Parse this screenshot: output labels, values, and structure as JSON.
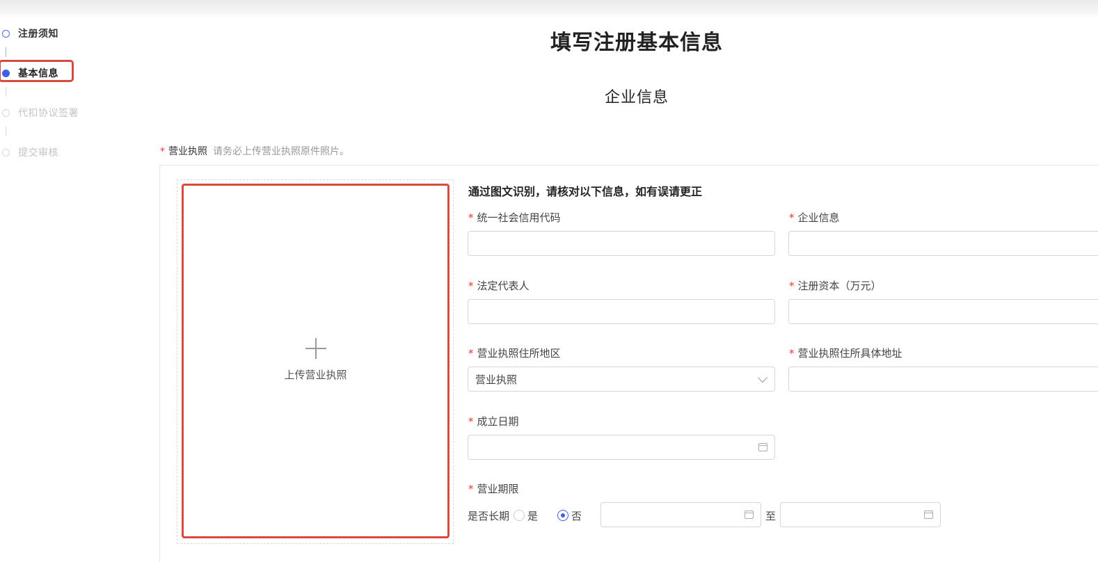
{
  "steps": [
    {
      "label": "注册须知",
      "state": "done"
    },
    {
      "label": "基本信息",
      "state": "active"
    },
    {
      "label": "代扣协议签署",
      "state": "pending"
    },
    {
      "label": "提交审核",
      "state": "pending"
    }
  ],
  "page_title": "填写注册基本信息",
  "section_title": "企业信息",
  "license": {
    "label": "营业执照",
    "hint": "请务必上传营业执照原件照片。",
    "upload_text": "上传营业执照"
  },
  "ocr_title": "通过图文识别，请核对以下信息，如有误请更正",
  "fields": {
    "credit_code": {
      "label": "统一社会信用代码",
      "value": ""
    },
    "company_info": {
      "label": "企业信息",
      "value": ""
    },
    "legal_rep": {
      "label": "法定代表人",
      "value": ""
    },
    "reg_capital": {
      "label": "注册资本（万元）",
      "value": ""
    },
    "region": {
      "label": "营业执照住所地区",
      "value": "营业执照"
    },
    "address": {
      "label": "营业执照住所具体地址",
      "value": ""
    },
    "found_date": {
      "label": "成立日期",
      "value": ""
    },
    "term": {
      "label": "营业期限",
      "long_term_label": "是否长期",
      "yes_label": "是",
      "no_label": "否",
      "selected": "否",
      "to_label": "至"
    }
  },
  "icons": {
    "plus": "plus-icon",
    "chevron": "chevron-down-icon",
    "calendar": "calendar-icon"
  },
  "colors": {
    "primary": "#3f5fe8",
    "required": "#ee3333",
    "highlight": "#d64a3f"
  }
}
